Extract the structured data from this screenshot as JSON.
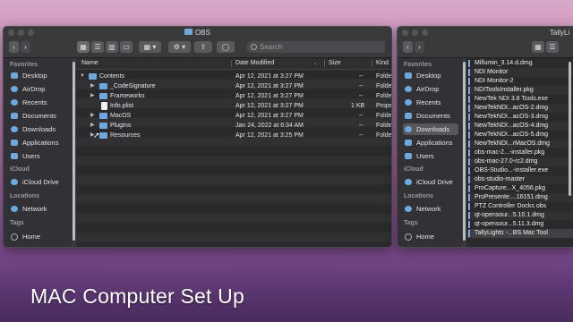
{
  "main_window": {
    "title": "OBS",
    "search_placeholder": "Search",
    "sidebar": {
      "favorites_label": "Favorites",
      "icloud_label": "iCloud",
      "locations_label": "Locations",
      "tags_label": "Tags",
      "favorites": [
        "Desktop",
        "AirDrop",
        "Recents",
        "Documents",
        "Downloads",
        "Applications",
        "Users"
      ],
      "icloud_items": [
        "iCloud Drive"
      ],
      "location_items": [
        "Network"
      ],
      "tag_items": [
        "Home"
      ]
    },
    "columns": {
      "name": "Name",
      "date": "Date Modified",
      "size": "Size",
      "kind": "Kind"
    },
    "rows": [
      {
        "name": "Contents",
        "date": "Apr 12, 2021 at 3:27 PM",
        "size": "--",
        "kind": "Folder"
      },
      {
        "name": "_CodeSignature",
        "date": "Apr 12, 2021 at 3:27 PM",
        "size": "--",
        "kind": "Folder"
      },
      {
        "name": "Frameworks",
        "date": "Apr 12, 2021 at 3:27 PM",
        "size": "--",
        "kind": "Folder"
      },
      {
        "name": "Info.plist",
        "date": "Apr 12, 2021 at 3:27 PM",
        "size": "1 KB",
        "kind": "Propert"
      },
      {
        "name": "MacOS",
        "date": "Apr 12, 2021 at 3:27 PM",
        "size": "--",
        "kind": "Folder"
      },
      {
        "name": "PlugIns",
        "date": "Jan 24, 2022 at 6:34 AM",
        "size": "--",
        "kind": "Folder"
      },
      {
        "name": "Resources",
        "date": "Apr 12, 2021 at 3:25 PM",
        "size": "--",
        "kind": "Folder"
      }
    ]
  },
  "side_window": {
    "title": "TallyLi",
    "sidebar": {
      "favorites_label": "Favorites",
      "icloud_label": "iCloud",
      "locations_label": "Locations",
      "tags_label": "Tags",
      "favorites": [
        "Desktop",
        "AirDrop",
        "Recents",
        "Documents",
        "Downloads",
        "Applications",
        "Users"
      ],
      "icloud_items": [
        "iCloud Drive"
      ],
      "location_items": [
        "Network"
      ],
      "tag_items": [
        "Home"
      ]
    },
    "files": [
      "Millumin_3.14.d.dmg",
      "NDI Monitor",
      "NDI Monitor-2",
      "NDIToolsInstaller.pkg",
      "NewTek NDI 3.8 Tools.exe",
      "NewTekNDI...acOS-2.dmg",
      "NewTekNDI...acOS-3.dmg",
      "NewTekNDI...acOS-4.dmg",
      "NewTekNDI...acOS-5.dmg",
      "NewTekNDI...rMacOS.dmg",
      "obs-mac-2...-installer.pkg",
      "obs-mac-27.0-rc2.dmg",
      "OBS-Studio...-installer.exe",
      "obs-studio-master",
      "ProCapture...X_4056.pkg",
      "ProPresente....16151.dmg",
      "PTZ Controller Docks obs",
      "qt-opensour...5.10.1.dmg",
      "qt-opensour...5.11.3.dmg",
      "TallyLights -...BS Mac Tool"
    ]
  },
  "caption": "MAC Computer Set Up"
}
